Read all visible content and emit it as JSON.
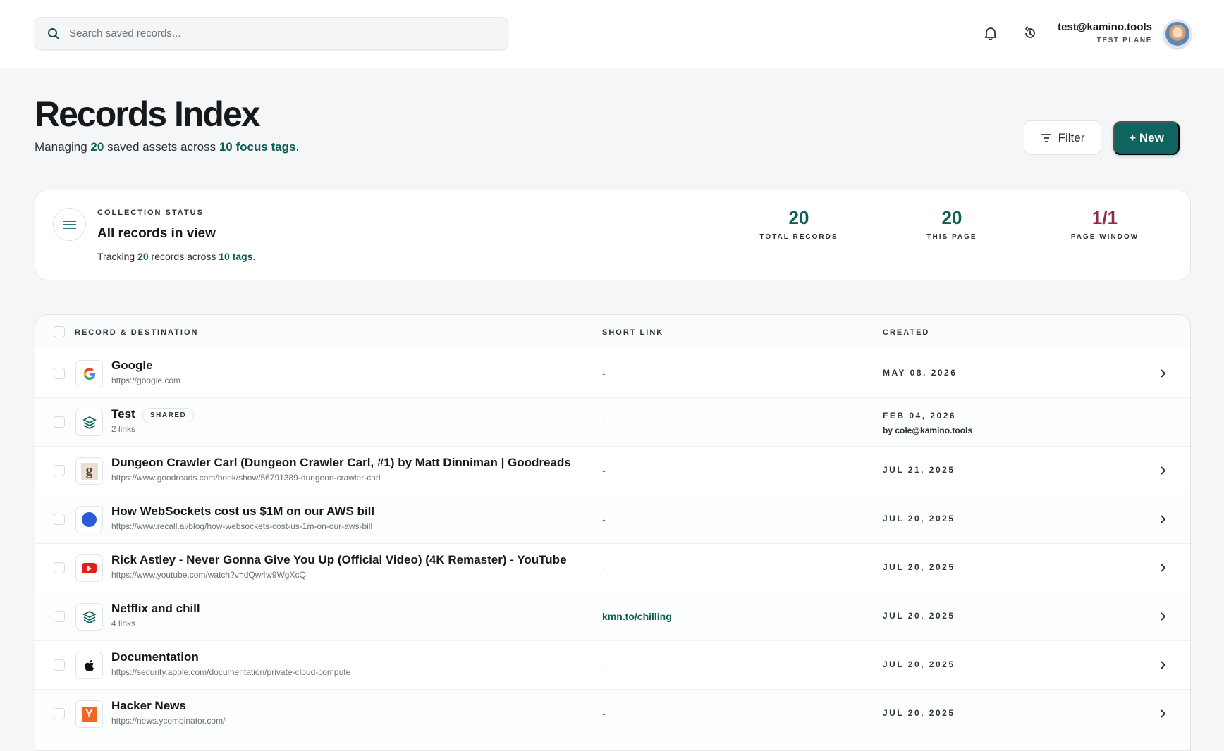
{
  "search": {
    "placeholder": "Search saved records..."
  },
  "user": {
    "email": "test@kamino.tools",
    "plan": "TEST PLANE"
  },
  "page": {
    "title": "Records Index",
    "subtitle_pre": "Managing",
    "saved_count": "20",
    "subtitle_mid": "saved assets across",
    "focus_tags": "10 focus tags",
    "subtitle_end": "."
  },
  "actions": {
    "filter_label": "Filter",
    "new_label": "+ New"
  },
  "status": {
    "label": "COLLECTION STATUS",
    "title": "All records in view",
    "text_pre": "Tracking",
    "records": "20",
    "text_mid": "records across",
    "tags": "10 tags",
    "text_end": ".",
    "metrics": [
      {
        "value": "20",
        "label": "TOTAL RECORDS"
      },
      {
        "value": "20",
        "label": "THIS PAGE"
      },
      {
        "value": "1/1",
        "label": "PAGE WINDOW"
      }
    ]
  },
  "table": {
    "headers": [
      "RECORD & DESTINATION",
      "SHORT LINK",
      "CREATED"
    ],
    "rows": [
      {
        "name": "Google",
        "url": "https://google.com",
        "short": "-",
        "date": "MAY 08, 2026",
        "icon": "google-icon"
      },
      {
        "name": "Test",
        "badge": "SHARED",
        "url": "2 links",
        "short": "-",
        "date": "FEB 04, 2026",
        "by": "by cole@kamino.tools",
        "icon": "layers-icon"
      },
      {
        "name": "Dungeon Crawler Carl (Dungeon Crawler Carl, #1) by Matt Dinniman | Goodreads",
        "url": "https://www.goodreads.com/book/show/56791389-dungeon-crawler-carl",
        "short": "-",
        "date": "JUL 21, 2025",
        "icon": "goodreads-icon"
      },
      {
        "name": "How WebSockets cost us $1M on our AWS bill",
        "url": "https://www.recall.ai/blog/how-websockets-cost-us-1m-on-our-aws-bill",
        "short": "-",
        "date": "JUL 20, 2025",
        "icon": "blue-dot-icon"
      },
      {
        "name": "Rick Astley - Never Gonna Give You Up (Official Video) (4K Remaster) - YouTube",
        "url": "https://www.youtube.com/watch?v=dQw4w9WgXcQ",
        "short": "-",
        "date": "JUL 20, 2025",
        "icon": "youtube-icon"
      },
      {
        "name": "Netflix and chill",
        "url": "4 links",
        "short": "kmn.to/chilling",
        "date": "JUL 20, 2025",
        "icon": "layers-icon"
      },
      {
        "name": "Documentation",
        "url": "https://security.apple.com/documentation/private-cloud-compute",
        "short": "-",
        "date": "JUL 20, 2025",
        "icon": "apple-icon"
      },
      {
        "name": "Hacker News",
        "url": "https://news.ycombinator.com/",
        "short": "-",
        "date": "JUL 20, 2025",
        "icon": "hacker-news-icon"
      }
    ]
  },
  "colors": {
    "accent": "#0e6560",
    "teal_text": "#0e5f55",
    "page_window": "#8f2b43"
  }
}
